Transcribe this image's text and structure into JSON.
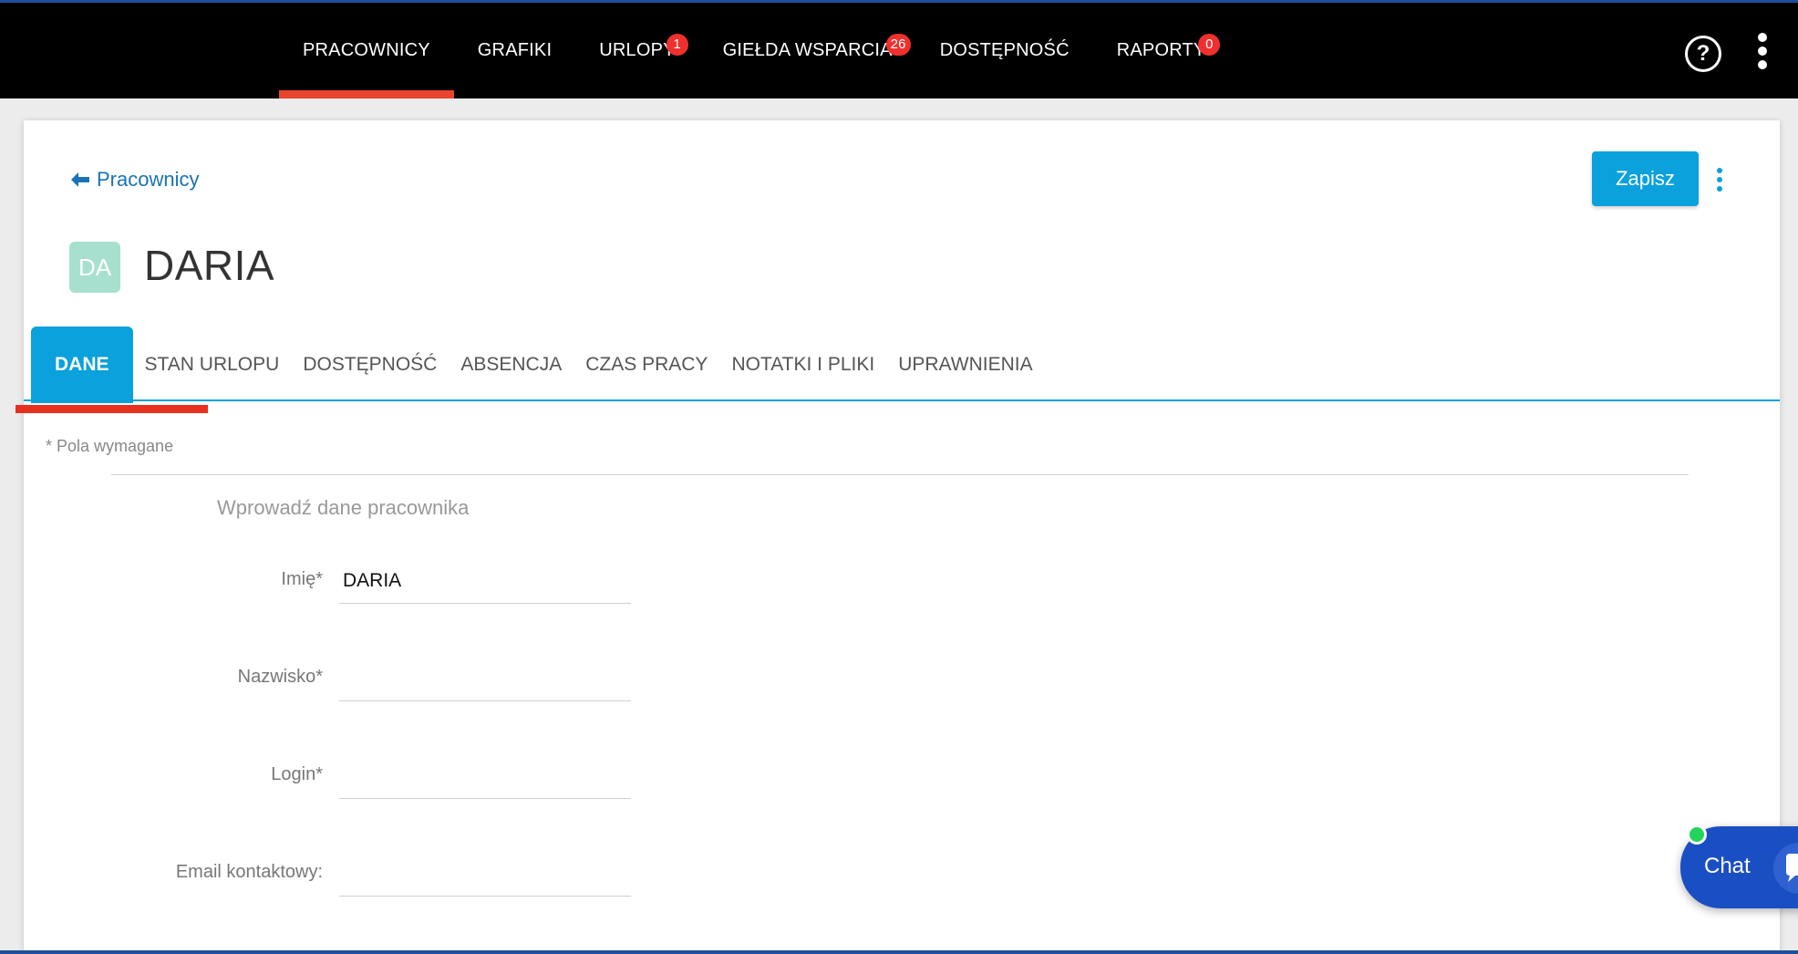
{
  "nav": {
    "items": [
      {
        "label": "PRACOWNICY",
        "badge": ""
      },
      {
        "label": "GRAFIKI",
        "badge": ""
      },
      {
        "label": "URLOPY",
        "badge": "1"
      },
      {
        "label": "GIEŁDA WSPARCIA",
        "badge": "26"
      },
      {
        "label": "DOSTĘPNOŚĆ",
        "badge": ""
      },
      {
        "label": "RAPORTY",
        "badge": "0"
      }
    ],
    "active": "PRACOWNICY",
    "help_icon": "help-circle-icon",
    "more_icon": "kebab-menu-icon"
  },
  "header": {
    "back_label": "Pracownicy",
    "save_label": "Zapisz",
    "avatar_initials": "DA",
    "employee_name": "DARIA"
  },
  "tabs": [
    {
      "label": "DANE",
      "active": true
    },
    {
      "label": "STAN URLOPU",
      "active": false
    },
    {
      "label": "DOSTĘPNOŚĆ",
      "active": false
    },
    {
      "label": "ABSENCJA",
      "active": false
    },
    {
      "label": "CZAS PRACY",
      "active": false
    },
    {
      "label": "NOTATKI I PLIKI",
      "active": false
    },
    {
      "label": "UPRAWNIENIA",
      "active": false
    }
  ],
  "form": {
    "required_note": "* Pola wymagane",
    "section_title": "Wprowadź dane pracownika",
    "fields": [
      {
        "label": "Imię*",
        "value": ""
      },
      {
        "label": "Nazwisko*",
        "value": ""
      },
      {
        "label": "Login*",
        "value": ""
      },
      {
        "label": "Email kontaktowy:",
        "value": ""
      }
    ],
    "first_name_value": "DARIA"
  },
  "chat": {
    "label": "Chat",
    "status_color": "#22d45b"
  },
  "colors": {
    "accent": "#0aa1dc",
    "nav_active": "#e8452e",
    "badge": "#f0302e",
    "link": "#1a73b5"
  }
}
